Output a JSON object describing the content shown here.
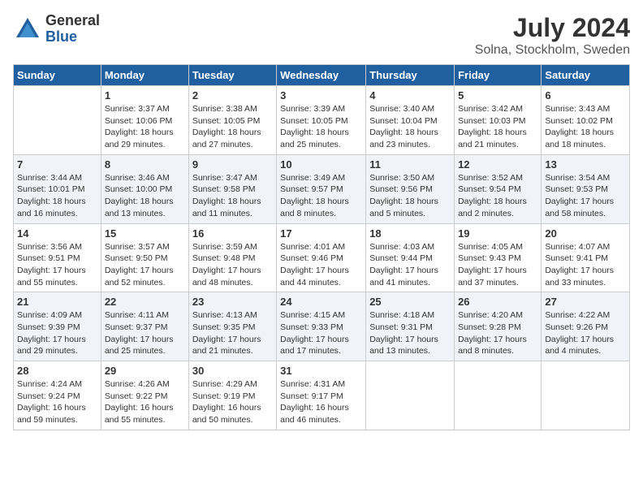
{
  "header": {
    "logo_general": "General",
    "logo_blue": "Blue",
    "title": "July 2024",
    "subtitle": "Solna, Stockholm, Sweden"
  },
  "days_of_week": [
    "Sunday",
    "Monday",
    "Tuesday",
    "Wednesday",
    "Thursday",
    "Friday",
    "Saturday"
  ],
  "weeks": [
    [
      {
        "day": "",
        "info": ""
      },
      {
        "day": "1",
        "info": "Sunrise: 3:37 AM\nSunset: 10:06 PM\nDaylight: 18 hours\nand 29 minutes."
      },
      {
        "day": "2",
        "info": "Sunrise: 3:38 AM\nSunset: 10:05 PM\nDaylight: 18 hours\nand 27 minutes."
      },
      {
        "day": "3",
        "info": "Sunrise: 3:39 AM\nSunset: 10:05 PM\nDaylight: 18 hours\nand 25 minutes."
      },
      {
        "day": "4",
        "info": "Sunrise: 3:40 AM\nSunset: 10:04 PM\nDaylight: 18 hours\nand 23 minutes."
      },
      {
        "day": "5",
        "info": "Sunrise: 3:42 AM\nSunset: 10:03 PM\nDaylight: 18 hours\nand 21 minutes."
      },
      {
        "day": "6",
        "info": "Sunrise: 3:43 AM\nSunset: 10:02 PM\nDaylight: 18 hours\nand 18 minutes."
      }
    ],
    [
      {
        "day": "7",
        "info": "Sunrise: 3:44 AM\nSunset: 10:01 PM\nDaylight: 18 hours\nand 16 minutes."
      },
      {
        "day": "8",
        "info": "Sunrise: 3:46 AM\nSunset: 10:00 PM\nDaylight: 18 hours\nand 13 minutes."
      },
      {
        "day": "9",
        "info": "Sunrise: 3:47 AM\nSunset: 9:58 PM\nDaylight: 18 hours\nand 11 minutes."
      },
      {
        "day": "10",
        "info": "Sunrise: 3:49 AM\nSunset: 9:57 PM\nDaylight: 18 hours\nand 8 minutes."
      },
      {
        "day": "11",
        "info": "Sunrise: 3:50 AM\nSunset: 9:56 PM\nDaylight: 18 hours\nand 5 minutes."
      },
      {
        "day": "12",
        "info": "Sunrise: 3:52 AM\nSunset: 9:54 PM\nDaylight: 18 hours\nand 2 minutes."
      },
      {
        "day": "13",
        "info": "Sunrise: 3:54 AM\nSunset: 9:53 PM\nDaylight: 17 hours\nand 58 minutes."
      }
    ],
    [
      {
        "day": "14",
        "info": "Sunrise: 3:56 AM\nSunset: 9:51 PM\nDaylight: 17 hours\nand 55 minutes."
      },
      {
        "day": "15",
        "info": "Sunrise: 3:57 AM\nSunset: 9:50 PM\nDaylight: 17 hours\nand 52 minutes."
      },
      {
        "day": "16",
        "info": "Sunrise: 3:59 AM\nSunset: 9:48 PM\nDaylight: 17 hours\nand 48 minutes."
      },
      {
        "day": "17",
        "info": "Sunrise: 4:01 AM\nSunset: 9:46 PM\nDaylight: 17 hours\nand 44 minutes."
      },
      {
        "day": "18",
        "info": "Sunrise: 4:03 AM\nSunset: 9:44 PM\nDaylight: 17 hours\nand 41 minutes."
      },
      {
        "day": "19",
        "info": "Sunrise: 4:05 AM\nSunset: 9:43 PM\nDaylight: 17 hours\nand 37 minutes."
      },
      {
        "day": "20",
        "info": "Sunrise: 4:07 AM\nSunset: 9:41 PM\nDaylight: 17 hours\nand 33 minutes."
      }
    ],
    [
      {
        "day": "21",
        "info": "Sunrise: 4:09 AM\nSunset: 9:39 PM\nDaylight: 17 hours\nand 29 minutes."
      },
      {
        "day": "22",
        "info": "Sunrise: 4:11 AM\nSunset: 9:37 PM\nDaylight: 17 hours\nand 25 minutes."
      },
      {
        "day": "23",
        "info": "Sunrise: 4:13 AM\nSunset: 9:35 PM\nDaylight: 17 hours\nand 21 minutes."
      },
      {
        "day": "24",
        "info": "Sunrise: 4:15 AM\nSunset: 9:33 PM\nDaylight: 17 hours\nand 17 minutes."
      },
      {
        "day": "25",
        "info": "Sunrise: 4:18 AM\nSunset: 9:31 PM\nDaylight: 17 hours\nand 13 minutes."
      },
      {
        "day": "26",
        "info": "Sunrise: 4:20 AM\nSunset: 9:28 PM\nDaylight: 17 hours\nand 8 minutes."
      },
      {
        "day": "27",
        "info": "Sunrise: 4:22 AM\nSunset: 9:26 PM\nDaylight: 17 hours\nand 4 minutes."
      }
    ],
    [
      {
        "day": "28",
        "info": "Sunrise: 4:24 AM\nSunset: 9:24 PM\nDaylight: 16 hours\nand 59 minutes."
      },
      {
        "day": "29",
        "info": "Sunrise: 4:26 AM\nSunset: 9:22 PM\nDaylight: 16 hours\nand 55 minutes."
      },
      {
        "day": "30",
        "info": "Sunrise: 4:29 AM\nSunset: 9:19 PM\nDaylight: 16 hours\nand 50 minutes."
      },
      {
        "day": "31",
        "info": "Sunrise: 4:31 AM\nSunset: 9:17 PM\nDaylight: 16 hours\nand 46 minutes."
      },
      {
        "day": "",
        "info": ""
      },
      {
        "day": "",
        "info": ""
      },
      {
        "day": "",
        "info": ""
      }
    ]
  ]
}
